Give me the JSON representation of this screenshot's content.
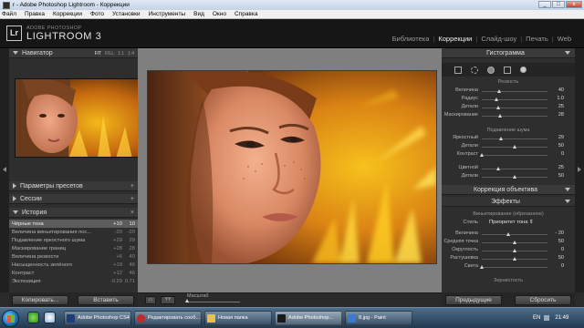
{
  "window": {
    "title": "r - Adobe Photoshop Lightroom - Коррекции",
    "controls": [
      "_",
      "□",
      "x"
    ]
  },
  "menu": [
    "Файл",
    "Правка",
    "Коррекции",
    "Фото",
    "Установки",
    "Инструменты",
    "Вид",
    "Окно",
    "Справка"
  ],
  "identity": {
    "logo": "Lr",
    "line1": "ADOBE PHOTOSHOP",
    "line2": "LIGHTROOM 3"
  },
  "modules": {
    "items": [
      "Библиотека",
      "Коррекции",
      "Слайд-шоу",
      "Печать",
      "Web"
    ],
    "active": "Коррекции"
  },
  "navigator": {
    "title": "Навигатор",
    "zoom": [
      "FIT",
      "FILL",
      "1:1",
      "1:4"
    ],
    "zoom_selected": "FIT"
  },
  "left_sections": {
    "presets": "Параметры пресетов",
    "sessions": "Сессии",
    "history": "История"
  },
  "history": [
    {
      "label": "Чёрные тона",
      "a": "+10",
      "b": "10",
      "selected": true
    },
    {
      "label": "Величина виньетирования пос...",
      "a": "-20",
      "b": "-20"
    },
    {
      "label": "Подавление яркостного шума",
      "a": "+29",
      "b": "29"
    },
    {
      "label": "Маскирование границ",
      "a": "+28",
      "b": "28"
    },
    {
      "label": "Величина резкости",
      "a": "+6",
      "b": "40"
    },
    {
      "label": "Насыщенность зелёного",
      "a": "+19",
      "b": "46"
    },
    {
      "label": "Контраст",
      "a": "+12",
      "b": "46"
    },
    {
      "label": "Экспозиция",
      "a": "-0.29",
      "b": "0.71"
    }
  ],
  "left_buttons": {
    "copy": "Копировать...",
    "paste": "Вставить"
  },
  "toolbar": {
    "zoom_label": "Масштаб"
  },
  "right_panel": {
    "histogram": "Гистограмма",
    "sharpening_title": "Резкость",
    "sharpening": [
      {
        "label": "Величина",
        "value": 40,
        "pos": 0.27
      },
      {
        "label": "Радиус",
        "value": "1.0",
        "pos": 0.22
      },
      {
        "label": "Детали",
        "value": 25,
        "pos": 0.25
      },
      {
        "label": "Маскирование",
        "value": 28,
        "pos": 0.28
      }
    ],
    "noise_title": "Подавление шума",
    "noise_lum": [
      {
        "label": "Яркостный",
        "value": 29,
        "pos": 0.29
      },
      {
        "label": "Детали",
        "value": 50,
        "pos": 0.5
      },
      {
        "label": "Контраст",
        "value": 0,
        "pos": 0.0
      }
    ],
    "noise_color": [
      {
        "label": "Цветной",
        "value": 25,
        "pos": 0.25
      },
      {
        "label": "Детали",
        "value": 50,
        "pos": 0.5
      }
    ],
    "lens_corrections": "Коррекция объектива",
    "effects": "Эффекты",
    "vignette_title": "Виньетирование (обрезанное)",
    "style_label": "Стиль",
    "style_value": "Приоритет тона ⇕",
    "vignette": [
      {
        "label": "Величина",
        "value": "- 20",
        "pos": 0.4
      },
      {
        "label": "Средняя точка",
        "value": 50,
        "pos": 0.5
      },
      {
        "label": "Округлость",
        "value": 0,
        "pos": 0.5
      },
      {
        "label": "Растушевка",
        "value": 50,
        "pos": 0.5
      },
      {
        "label": "Света",
        "value": 0,
        "pos": 0.0
      }
    ],
    "grain_title": "Зернистость"
  },
  "right_buttons": {
    "previous": "Предыдущие",
    "reset": "Сбросить"
  },
  "taskbar": {
    "tasks": [
      {
        "label": "Adobe Photoshop CS4",
        "color": "#1c3f7a"
      },
      {
        "label": "Редактировать сооб...",
        "color": "#c02a2a"
      },
      {
        "label": "Новая папка",
        "color": "#e8c050"
      },
      {
        "label": "Adobe Photoshop...",
        "color": "#1a1a1a",
        "active": true
      },
      {
        "label": "8.jpg - Paint",
        "color": "#3a7ad0"
      }
    ],
    "lang": "EN",
    "time": "21:49"
  }
}
